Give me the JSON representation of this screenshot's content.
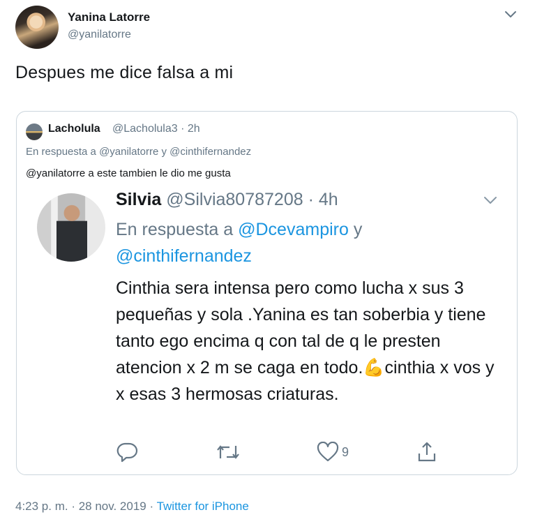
{
  "tweet": {
    "author_name": "Yanina Latorre",
    "author_handle": "@yanilatorre",
    "text": "Despues me dice falsa a mi",
    "timestamp": "4:23 p. m. · 28 nov. 2019 · ",
    "source": "Twitter for iPhone"
  },
  "quote": {
    "author_name": "Lacholula",
    "handle_time": "@Lacholula3 · 2h",
    "reply_to": "En respuesta a @yanilatorre y @cinthifernandez",
    "text": "@yanilatorre a este tambien le dio me gusta"
  },
  "screenshot_tweet": {
    "author_name": "Silvia",
    "handle_time": "@Silvia80787208 · 4h",
    "reply_prefix": "En respuesta a ",
    "mention_1": "@Dcevampiro",
    "reply_and": " y",
    "mention_2": "@cinthifernandez",
    "text_part_1": "Cinthia sera intensa pero como lucha x sus 3 pequeñas y sola .Yanina es tan soberbia y tiene tanto ego encima q con tal de q le presten atencion x 2 m se caga en todo.",
    "emoji": "💪",
    "text_part_2": "cinthia x vos y x esas 3 hermosas criaturas.",
    "like_count": "9"
  },
  "icons": {
    "caret": "chevron-down-icon",
    "reply": "reply-icon",
    "retweet": "retweet-icon",
    "like": "heart-icon",
    "share": "share-icon"
  },
  "colors": {
    "link": "#1b95e0",
    "secondary_text": "#657786",
    "border": "#ccd6dd",
    "flex_emoji": "#f4b400"
  }
}
